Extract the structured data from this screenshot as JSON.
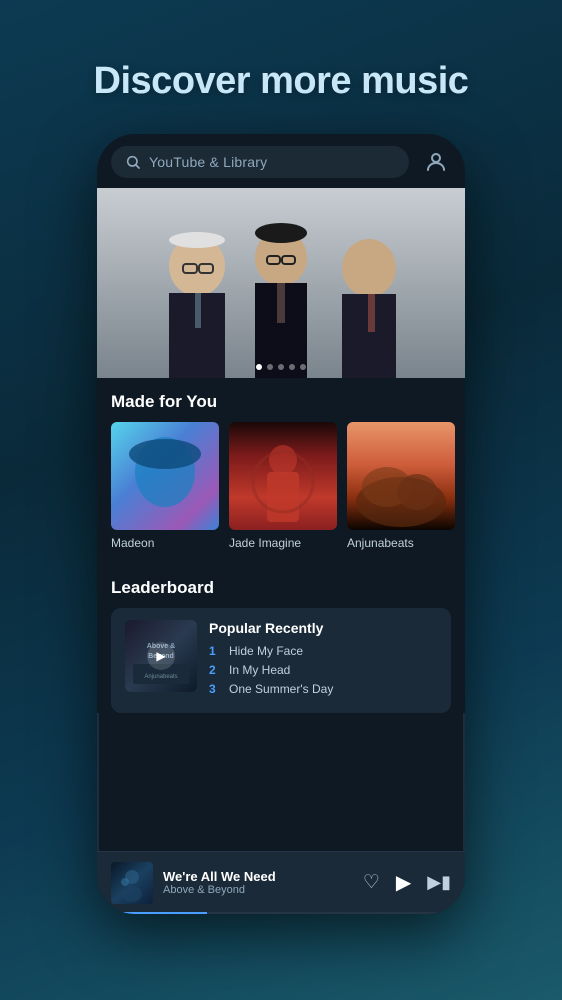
{
  "hero": {
    "title": "Discover more music"
  },
  "search": {
    "placeholder": "YouTube & Library",
    "icon": "search"
  },
  "banner": {
    "carousel_dots": 5,
    "active_dot": 0
  },
  "made_for_you": {
    "section_title": "Made for You",
    "albums": [
      {
        "id": "madeon",
        "label": "Madeon"
      },
      {
        "id": "jade",
        "label": "Jade Imagine"
      },
      {
        "id": "anjuna",
        "label": "Anjunabeats"
      }
    ]
  },
  "leaderboard": {
    "section_title": "Leaderboard",
    "card_title": "Popular Recently",
    "tracks": [
      {
        "num": "1",
        "name": "Hide My Face"
      },
      {
        "num": "2",
        "name": "In My Head"
      },
      {
        "num": "3",
        "name": "One Summer's Day"
      }
    ]
  },
  "now_playing": {
    "title": "We're All We Need",
    "artist": "Above & Beyond",
    "progress": 30
  }
}
